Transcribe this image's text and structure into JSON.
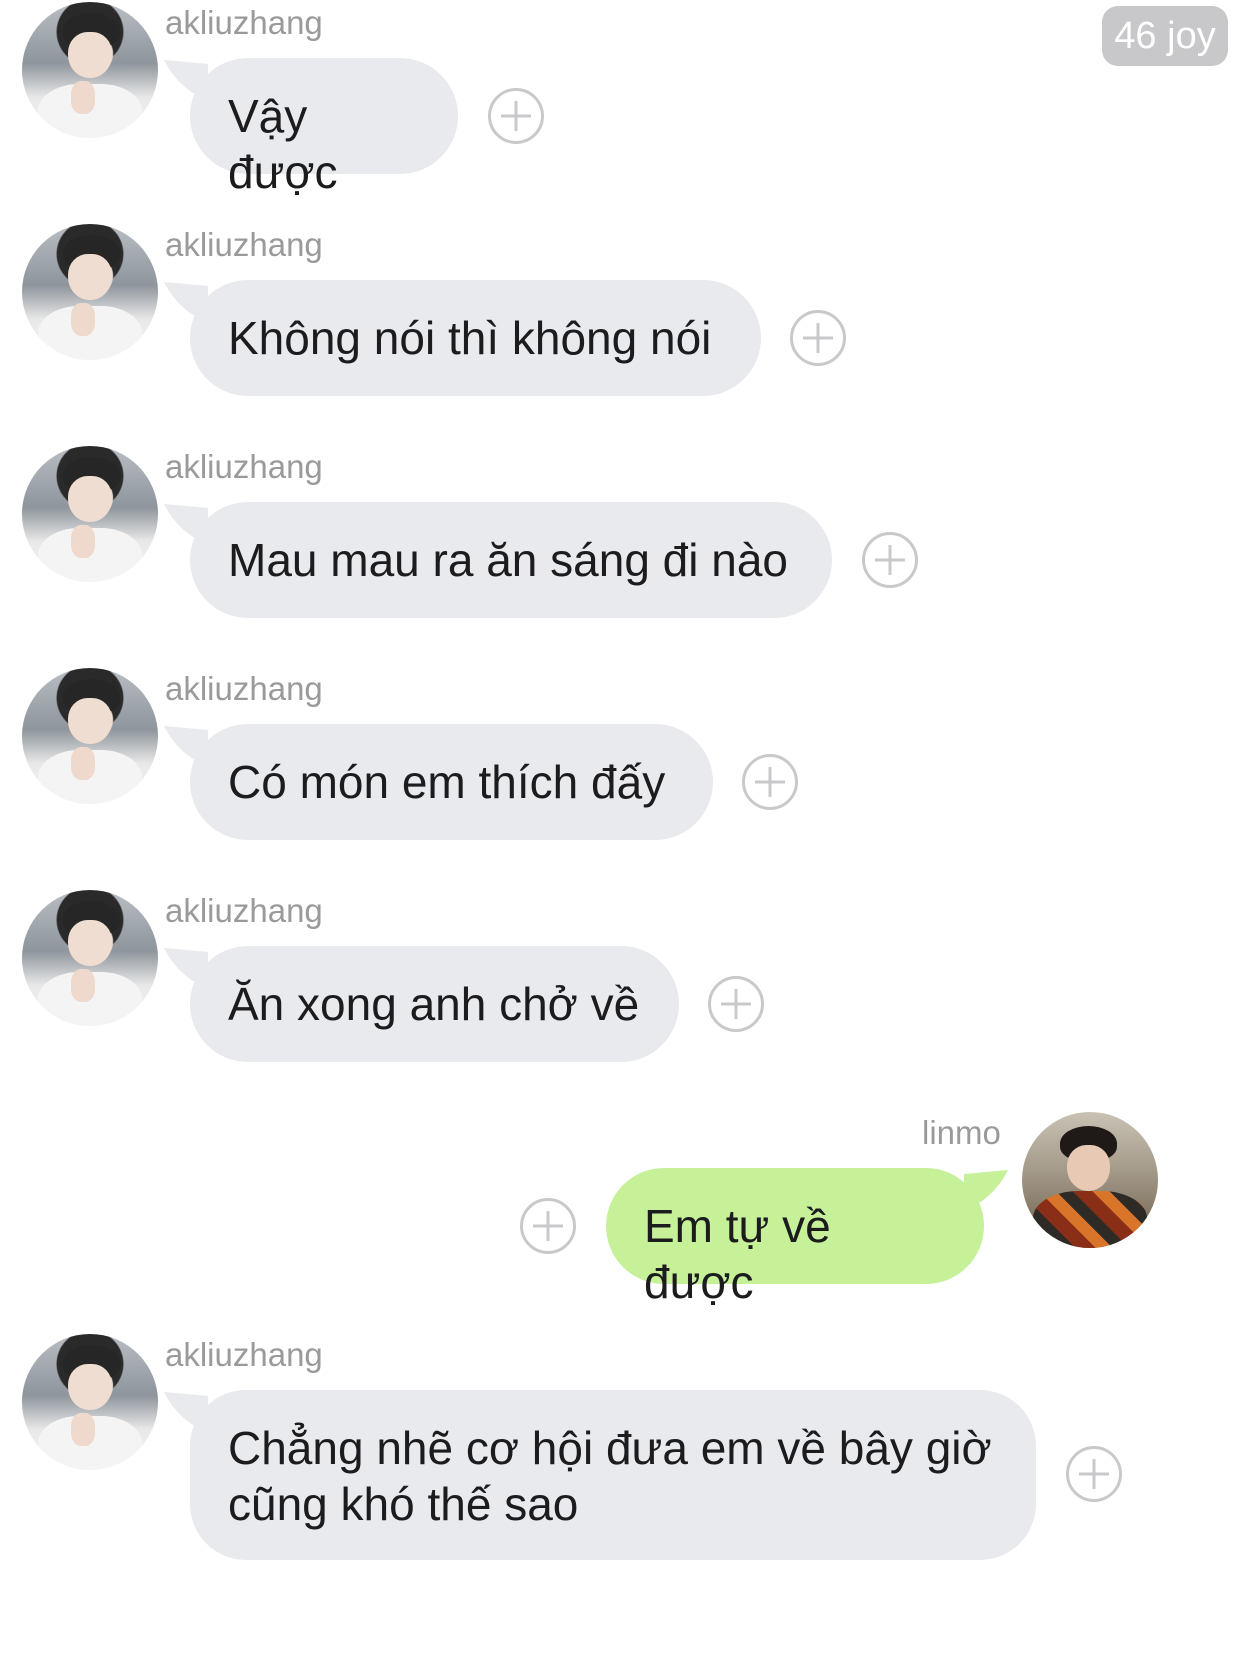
{
  "header": {
    "badge": "46 joy"
  },
  "messages": [
    {
      "sender": "akliuzhang",
      "direction": "incoming",
      "text": "Vậy được"
    },
    {
      "sender": "akliuzhang",
      "direction": "incoming",
      "text": "Không nói thì không nói"
    },
    {
      "sender": "akliuzhang",
      "direction": "incoming",
      "text": "Mau mau ra ăn sáng đi nào"
    },
    {
      "sender": "akliuzhang",
      "direction": "incoming",
      "text": "Có món em thích đấy"
    },
    {
      "sender": "akliuzhang",
      "direction": "incoming",
      "text": "Ăn xong anh chở về"
    },
    {
      "sender": "linmo",
      "direction": "outgoing",
      "text": "Em tự về được"
    },
    {
      "sender": "akliuzhang",
      "direction": "incoming",
      "text": "Chẳng nhẽ cơ hội đưa em về bây giờ cũng khó thế sao"
    }
  ],
  "colors": {
    "incoming_bubble": "#e9eaed",
    "outgoing_bubble": "#c7f199",
    "name_text": "#9a9a9a",
    "badge": "#c8c8ca"
  },
  "icons": {
    "react_button": "plus-circle-icon"
  }
}
